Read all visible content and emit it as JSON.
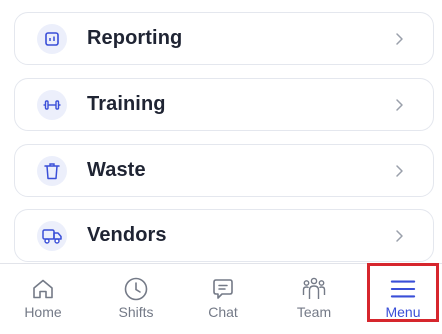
{
  "menu": {
    "items": [
      {
        "label": "Reporting",
        "icon": "reporting-icon"
      },
      {
        "label": "Training",
        "icon": "dumbbell-icon"
      },
      {
        "label": "Waste",
        "icon": "trash-icon"
      },
      {
        "label": "Vendors",
        "icon": "truck-icon"
      }
    ]
  },
  "tabbar": {
    "tabs": [
      {
        "label": "Home",
        "icon": "home-icon"
      },
      {
        "label": "Shifts",
        "icon": "clock-icon"
      },
      {
        "label": "Chat",
        "icon": "chat-icon"
      },
      {
        "label": "Team",
        "icon": "team-icon"
      },
      {
        "label": "Menu",
        "icon": "hamburger-icon",
        "active": true
      }
    ]
  },
  "colors": {
    "accent": "#3a4fd8",
    "icon_bg": "#eceffb",
    "highlight": "#d6262d",
    "text": "#1f2433",
    "muted": "#747a87"
  }
}
